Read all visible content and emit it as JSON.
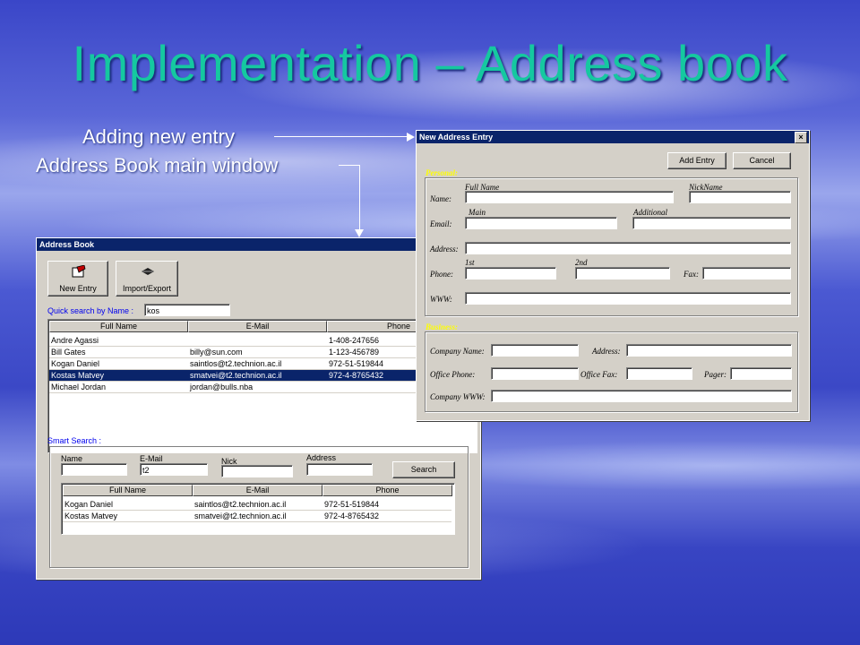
{
  "slide": {
    "title": "Implementation – Address book",
    "caption_new_entry": "Adding new entry",
    "caption_main_window": "Address Book main window"
  },
  "address_book": {
    "title": "Address Book",
    "toolbar": {
      "new_entry_label": "New Entry",
      "import_export_label": "Import/Export"
    },
    "quick_search": {
      "label": "Quick search by Name :",
      "value": "kos"
    },
    "columns": [
      "Full Name",
      "E-Mail",
      "Phone"
    ],
    "rows": [
      {
        "name": "Andre Agassi",
        "email": "",
        "phone": "1-408-247656"
      },
      {
        "name": "Bill Gates",
        "email": "billy@sun.com",
        "phone": "1-123-456789"
      },
      {
        "name": "Kogan Daniel",
        "email": "saintlos@t2.technion.ac.il",
        "phone": "972-51-519844"
      },
      {
        "name": "Kostas Matvey",
        "email": "smatvei@t2.technion.ac.il",
        "phone": "972-4-8765432"
      },
      {
        "name": "Michael Jordan",
        "email": "jordan@bulls.nba",
        "phone": ""
      }
    ],
    "smart_search": {
      "label": "Smart Search :",
      "name_label": "Name",
      "email_label": "E-Mail",
      "email_value": "t2",
      "nick_label": "Nick",
      "address_label": "Address",
      "search_button": "Search",
      "columns": [
        "Full Name",
        "E-Mail",
        "Phone"
      ],
      "results": [
        {
          "name": "Kogan Daniel",
          "email": "saintlos@t2.technion.ac.il",
          "phone": "972-51-519844"
        },
        {
          "name": "Kostas Matvey",
          "email": "smatvei@t2.technion.ac.il",
          "phone": "972-4-8765432"
        }
      ]
    }
  },
  "new_entry": {
    "title": "New Address Entry",
    "close_glyph": "×",
    "add_button": "Add Entry",
    "cancel_button": "Cancel",
    "personal": {
      "section": "Personal:",
      "name_label": "Name:",
      "full_name": "Full Name",
      "nickname": "NickName",
      "email_label": "Email:",
      "main": "Main",
      "additional": "Additional",
      "address_label": "Address:",
      "phone_label": "Phone:",
      "first": "1st",
      "second": "2nd",
      "fax_label": "Fax:",
      "www_label": "WWW:"
    },
    "business": {
      "section": "Business:",
      "company_name": "Company Name:",
      "address": "Address:",
      "office_phone": "Office Phone:",
      "office_fax": "Office Fax:",
      "pager": "Pager:",
      "company_www": "Company WWW:"
    }
  }
}
